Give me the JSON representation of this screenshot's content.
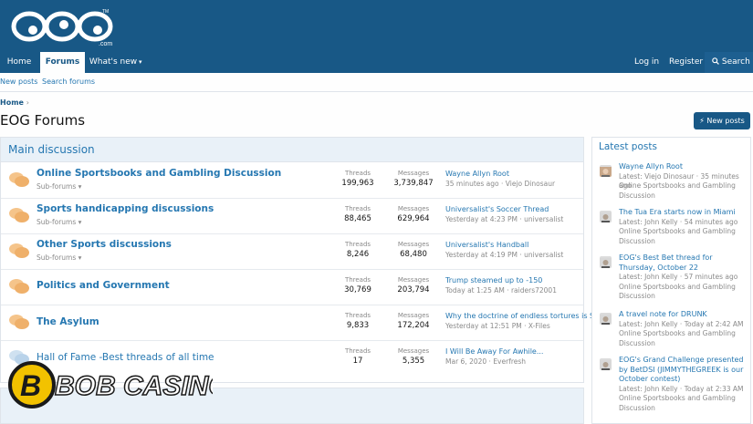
{
  "site": {
    "logo_text": "EOG",
    "logo_suffix": ".com",
    "logo_tm": "TM"
  },
  "nav": {
    "home": "Home",
    "forums": "Forums",
    "whats_new": "What's new",
    "login": "Log in",
    "register": "Register",
    "search": "Search"
  },
  "subnav": {
    "new_posts": "New posts",
    "search_forums": "Search forums"
  },
  "breadcrumb": {
    "home": "Home"
  },
  "page": {
    "title": "EOG Forums",
    "new_posts_button": "New posts"
  },
  "main": {
    "header": "Main discussion",
    "threads_label": "Threads",
    "messages_label": "Messages",
    "subforums_label": "Sub-forums",
    "forums": [
      {
        "title": "Online Sportsbooks and Gambling Discussion",
        "threads": "199,963",
        "messages": "3,739,847",
        "last_title": "Wayne Allyn Root",
        "last_meta": "35 minutes ago · Viejo Dinosaur",
        "has_sub": true
      },
      {
        "title": "Sports handicapping discussions",
        "threads": "88,465",
        "messages": "629,964",
        "last_title": "Universalist's Soccer Thread",
        "last_meta": "Yesterday at 4:23 PM · universalist",
        "has_sub": true
      },
      {
        "title": "Other Sports discussions",
        "threads": "8,246",
        "messages": "68,480",
        "last_title": "Universalist's Handball",
        "last_meta": "Yesterday at 4:19 PM · universalist",
        "has_sub": true
      },
      {
        "title": "Politics and Government",
        "threads": "30,769",
        "messages": "203,794",
        "last_title": "Trump steamed up to -150",
        "last_meta": "Today at 1:25 AM · raiders72001",
        "has_sub": false
      },
      {
        "title": "The Asylum",
        "threads": "9,833",
        "messages": "172,204",
        "last_title": "Why the doctrine of endless tortures is S...",
        "last_meta": "Yesterday at 12:51 PM · X-Files",
        "has_sub": false
      },
      {
        "title": "Hall of Fame -Best threads of all time",
        "threads": "17",
        "messages": "5,355",
        "last_title": "I Will Be Away For Awhile...",
        "last_meta": "Mar 6, 2020 · Everfresh",
        "has_sub": false
      }
    ]
  },
  "sidebar": {
    "header": "Latest posts",
    "posts": [
      {
        "title": "Wayne Allyn Root",
        "meta1": "Latest: Viejo Dinosaur · 35 minutes ago",
        "meta2": "Online Sportsbooks and Gambling",
        "meta3": "Discussion"
      },
      {
        "title": "The Tua Era starts now in Miami",
        "meta1": "Latest: John Kelly · 54 minutes ago",
        "meta2": "Online Sportsbooks and Gambling",
        "meta3": "Discussion"
      },
      {
        "title": "EOG's Best Bet thread for Thursday, October 22",
        "meta1": "Latest: John Kelly · 57 minutes ago",
        "meta2": "Online Sportsbooks and Gambling",
        "meta3": "Discussion"
      },
      {
        "title": "A travel note for DRUNK",
        "meta1": "Latest: John Kelly · Today at 2:42 AM",
        "meta2": "Online Sportsbooks and Gambling",
        "meta3": "Discussion"
      },
      {
        "title": "EOG's Grand Challenge presented by BetDSI (JIMMYTHEGREEK is our October contest)",
        "meta1": "Latest: John Kelly · Today at 2:33 AM",
        "meta2": "Online Sportsbooks and Gambling",
        "meta3": "Discussion"
      }
    ]
  },
  "watermark": {
    "text": "BOB CASINO"
  },
  "colors": {
    "brand": "#185886",
    "link": "#2577b1",
    "icon": "#f5c48a"
  }
}
